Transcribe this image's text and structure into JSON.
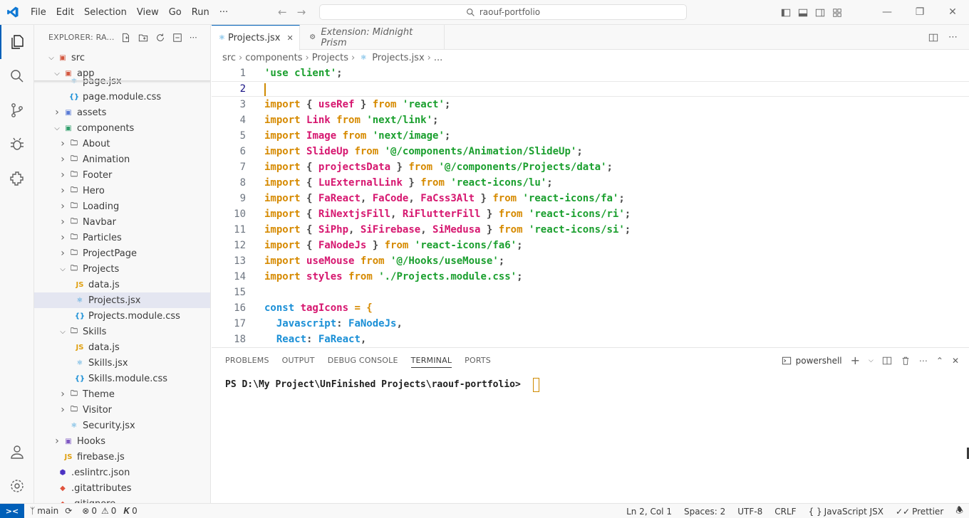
{
  "menu": [
    "File",
    "Edit",
    "Selection",
    "View",
    "Go",
    "Run",
    "···"
  ],
  "search": {
    "text": "raouf-portfolio"
  },
  "explorer": {
    "title": "EXPLORER: RA..."
  },
  "tree": [
    {
      "label": "src",
      "depth": 0,
      "kind": "folder-src",
      "open": true
    },
    {
      "label": "app",
      "depth": 1,
      "kind": "folder-app",
      "open": true
    },
    {
      "label": "page.jsx",
      "depth": 2,
      "kind": "react"
    },
    {
      "label": "page.module.css",
      "depth": 2,
      "kind": "css"
    },
    {
      "label": "assets",
      "depth": 1,
      "kind": "folder-assets",
      "open": false
    },
    {
      "label": "components",
      "depth": 1,
      "kind": "folder-components",
      "open": true
    },
    {
      "label": "About",
      "depth": 2,
      "kind": "folder",
      "open": false
    },
    {
      "label": "Animation",
      "depth": 2,
      "kind": "folder",
      "open": false
    },
    {
      "label": "Footer",
      "depth": 2,
      "kind": "folder",
      "open": false
    },
    {
      "label": "Hero",
      "depth": 2,
      "kind": "folder",
      "open": false
    },
    {
      "label": "Loading",
      "depth": 2,
      "kind": "folder",
      "open": false
    },
    {
      "label": "Navbar",
      "depth": 2,
      "kind": "folder",
      "open": false
    },
    {
      "label": "Particles",
      "depth": 2,
      "kind": "folder",
      "open": false
    },
    {
      "label": "ProjectPage",
      "depth": 2,
      "kind": "folder",
      "open": false
    },
    {
      "label": "Projects",
      "depth": 2,
      "kind": "folder",
      "open": true
    },
    {
      "label": "data.js",
      "depth": 3,
      "kind": "js"
    },
    {
      "label": "Projects.jsx",
      "depth": 3,
      "kind": "react",
      "selected": true
    },
    {
      "label": "Projects.module.css",
      "depth": 3,
      "kind": "css"
    },
    {
      "label": "Skills",
      "depth": 2,
      "kind": "folder",
      "open": true
    },
    {
      "label": "data.js",
      "depth": 3,
      "kind": "js"
    },
    {
      "label": "Skills.jsx",
      "depth": 3,
      "kind": "react"
    },
    {
      "label": "Skills.module.css",
      "depth": 3,
      "kind": "css"
    },
    {
      "label": "Theme",
      "depth": 2,
      "kind": "folder",
      "open": false
    },
    {
      "label": "Visitor",
      "depth": 2,
      "kind": "folder",
      "open": false
    },
    {
      "label": "Security.jsx",
      "depth": 2,
      "kind": "react"
    },
    {
      "label": "Hooks",
      "depth": 1,
      "kind": "folder-hooks",
      "open": false
    },
    {
      "label": "firebase.js",
      "depth": 1,
      "kind": "js"
    },
    {
      "label": ".eslintrc.json",
      "depth": 0,
      "kind": "eslint"
    },
    {
      "label": ".gitattributes",
      "depth": 0,
      "kind": "git"
    },
    {
      "label": ".gitignore",
      "depth": 0,
      "kind": "git"
    }
  ],
  "tabs": [
    {
      "label": "Projects.jsx",
      "active": true
    },
    {
      "label": "Extension: Midnight Prism",
      "active": false
    }
  ],
  "breadcrumb": [
    "src",
    "components",
    "Projects",
    "Projects.jsx",
    "..."
  ],
  "code": [
    {
      "n": "1",
      "t": [
        [
          "s",
          "'use client'"
        ],
        [
          "p",
          ";"
        ]
      ]
    },
    {
      "n": "2",
      "t": [],
      "current": true
    },
    {
      "n": "3",
      "t": [
        [
          "k",
          "import "
        ],
        [
          "p",
          "{ "
        ],
        [
          "id",
          "useRef"
        ],
        [
          "p",
          " } "
        ],
        [
          "k",
          "from "
        ],
        [
          "s",
          "'react'"
        ],
        [
          "p",
          ";"
        ]
      ]
    },
    {
      "n": "4",
      "t": [
        [
          "k",
          "import "
        ],
        [
          "id",
          "Link "
        ],
        [
          "k",
          "from "
        ],
        [
          "s",
          "'next/link'"
        ],
        [
          "p",
          ";"
        ]
      ]
    },
    {
      "n": "5",
      "t": [
        [
          "k",
          "import "
        ],
        [
          "id",
          "Image "
        ],
        [
          "k",
          "from "
        ],
        [
          "s",
          "'next/image'"
        ],
        [
          "p",
          ";"
        ]
      ]
    },
    {
      "n": "6",
      "t": [
        [
          "k",
          "import "
        ],
        [
          "id",
          "SlideUp "
        ],
        [
          "k",
          "from "
        ],
        [
          "s",
          "'@/components/Animation/SlideUp'"
        ],
        [
          "p",
          ";"
        ]
      ]
    },
    {
      "n": "7",
      "t": [
        [
          "k",
          "import "
        ],
        [
          "p",
          "{ "
        ],
        [
          "id",
          "projectsData"
        ],
        [
          "p",
          " } "
        ],
        [
          "k",
          "from "
        ],
        [
          "s",
          "'@/components/Projects/data'"
        ],
        [
          "p",
          ";"
        ]
      ]
    },
    {
      "n": "8",
      "t": [
        [
          "k",
          "import "
        ],
        [
          "p",
          "{ "
        ],
        [
          "id",
          "LuExternalLink"
        ],
        [
          "p",
          " } "
        ],
        [
          "k",
          "from "
        ],
        [
          "s",
          "'react-icons/lu'"
        ],
        [
          "p",
          ";"
        ]
      ]
    },
    {
      "n": "9",
      "t": [
        [
          "k",
          "import "
        ],
        [
          "p",
          "{ "
        ],
        [
          "id",
          "FaReact"
        ],
        [
          "p",
          ", "
        ],
        [
          "id",
          "FaCode"
        ],
        [
          "p",
          ", "
        ],
        [
          "id",
          "FaCss3Alt"
        ],
        [
          "p",
          " } "
        ],
        [
          "k",
          "from "
        ],
        [
          "s",
          "'react-icons/fa'"
        ],
        [
          "p",
          ";"
        ]
      ]
    },
    {
      "n": "10",
      "t": [
        [
          "k",
          "import "
        ],
        [
          "p",
          "{ "
        ],
        [
          "id",
          "RiNextjsFill"
        ],
        [
          "p",
          ", "
        ],
        [
          "id",
          "RiFlutterFill"
        ],
        [
          "p",
          " } "
        ],
        [
          "k",
          "from "
        ],
        [
          "s",
          "'react-icons/ri'"
        ],
        [
          "p",
          ";"
        ]
      ]
    },
    {
      "n": "11",
      "t": [
        [
          "k",
          "import "
        ],
        [
          "p",
          "{ "
        ],
        [
          "id",
          "SiPhp"
        ],
        [
          "p",
          ", "
        ],
        [
          "id",
          "SiFirebase"
        ],
        [
          "p",
          ", "
        ],
        [
          "id",
          "SiMedusa"
        ],
        [
          "p",
          " } "
        ],
        [
          "k",
          "from "
        ],
        [
          "s",
          "'react-icons/si'"
        ],
        [
          "p",
          ";"
        ]
      ]
    },
    {
      "n": "12",
      "t": [
        [
          "k",
          "import "
        ],
        [
          "p",
          "{ "
        ],
        [
          "id",
          "FaNodeJs"
        ],
        [
          "p",
          " } "
        ],
        [
          "k",
          "from "
        ],
        [
          "s",
          "'react-icons/fa6'"
        ],
        [
          "p",
          ";"
        ]
      ]
    },
    {
      "n": "13",
      "t": [
        [
          "k",
          "import "
        ],
        [
          "id",
          "useMouse "
        ],
        [
          "k",
          "from "
        ],
        [
          "s",
          "'@/Hooks/useMouse'"
        ],
        [
          "p",
          ";"
        ]
      ]
    },
    {
      "n": "14",
      "t": [
        [
          "k",
          "import "
        ],
        [
          "id",
          "styles "
        ],
        [
          "k",
          "from "
        ],
        [
          "s",
          "'./Projects.module.css'"
        ],
        [
          "p",
          ";"
        ]
      ]
    },
    {
      "n": "15",
      "t": []
    },
    {
      "n": "16",
      "t": [
        [
          "c",
          "const "
        ],
        [
          "id",
          "tagIcons "
        ],
        [
          "k",
          "= {"
        ]
      ]
    },
    {
      "n": "17",
      "t": [
        [
          "p",
          "  "
        ],
        [
          "c",
          "Javascript"
        ],
        [
          "p",
          ": "
        ],
        [
          "c",
          "FaNodeJs"
        ],
        [
          "p",
          ","
        ]
      ]
    },
    {
      "n": "18",
      "t": [
        [
          "p",
          "  "
        ],
        [
          "c",
          "React"
        ],
        [
          "p",
          ": "
        ],
        [
          "c",
          "FaReact"
        ],
        [
          "p",
          ","
        ]
      ]
    }
  ],
  "panel": {
    "tabs": [
      "PROBLEMS",
      "OUTPUT",
      "DEBUG CONSOLE",
      "TERMINAL",
      "PORTS"
    ],
    "active_tab": "TERMINAL",
    "shell": "powershell",
    "prompt": "PS D:\\My Project\\UnFinished Projects\\raouf-portfolio>"
  },
  "status": {
    "branch": "main",
    "errors": "0",
    "warnings": "0",
    "ports": "0",
    "position": "Ln 2, Col 1",
    "spaces": "Spaces: 2",
    "encoding": "UTF-8",
    "eol": "CRLF",
    "language": "JavaScript JSX",
    "formatter": "Prettier"
  },
  "colors": {
    "accent": "#005fb8",
    "keyword": "#d68a00",
    "identifier": "#d6166f",
    "string": "#1a9f2e",
    "constant": "#1a8fd6"
  }
}
